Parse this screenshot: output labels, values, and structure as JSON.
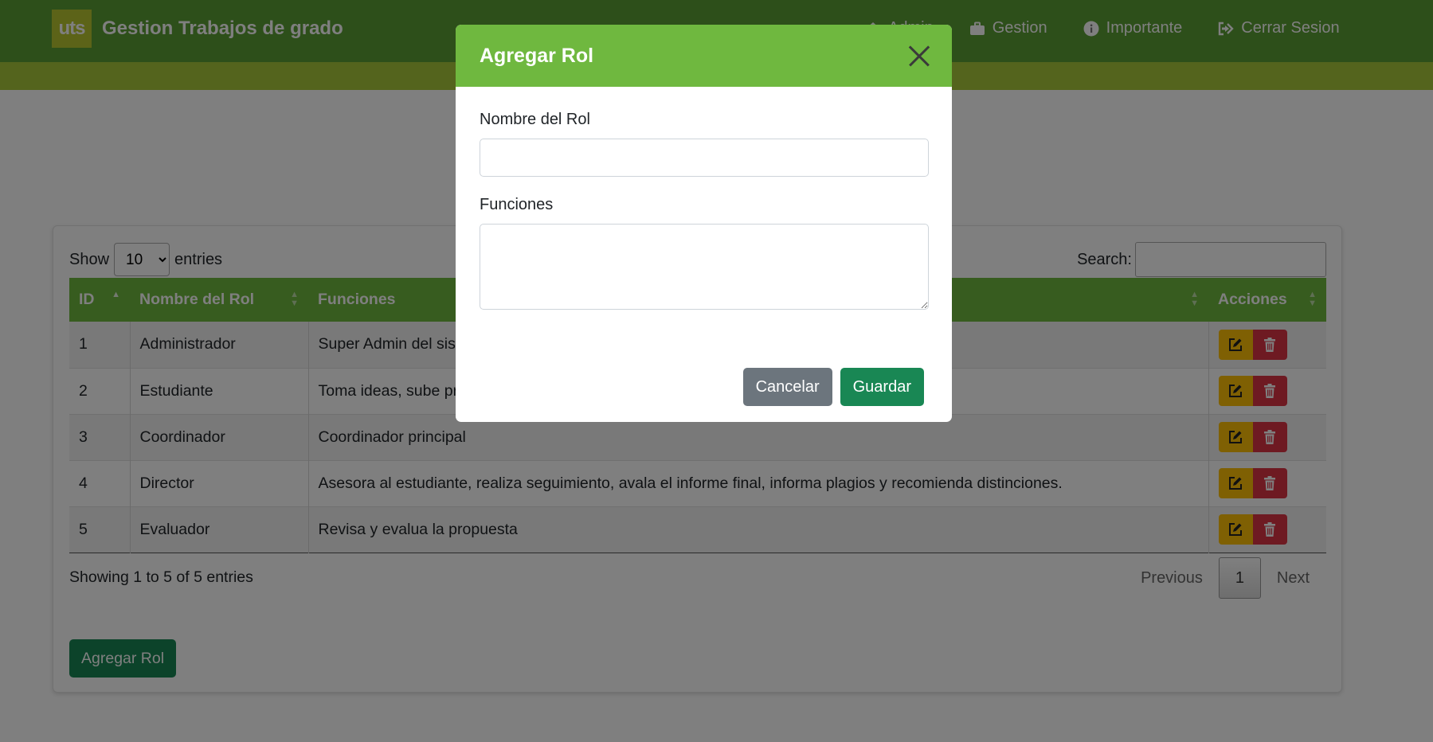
{
  "navbar": {
    "logo_text": "uts",
    "title": "Gestion Trabajos de grado",
    "links": [
      {
        "label": "Admin",
        "icon": "home-icon"
      },
      {
        "label": "Gestion",
        "icon": "briefcase-icon"
      },
      {
        "label": "Importante",
        "icon": "info-icon"
      },
      {
        "label": "Cerrar Sesion",
        "icon": "sign-out-icon"
      }
    ],
    "colors": {
      "bar": "#5a9e34",
      "stripe": "#a8c93a"
    }
  },
  "table_controls": {
    "show_label": "Show",
    "entries_value": "10",
    "entries_label": "entries",
    "search_label": "Search:"
  },
  "table": {
    "headers": [
      "ID",
      "Nombre del Rol",
      "Funciones",
      "Acciones"
    ],
    "rows": [
      {
        "id": "1",
        "name": "Administrador",
        "functions": "Super Admin del sis"
      },
      {
        "id": "2",
        "name": "Estudiante",
        "functions": "Toma ideas, sube pr"
      },
      {
        "id": "3",
        "name": "Coordinador",
        "functions": "Coordinador principal"
      },
      {
        "id": "4",
        "name": "Director",
        "functions": "Asesora al estudiante, realiza seguimiento, avala el informe final, informa plagios y recomienda distinciones."
      },
      {
        "id": "5",
        "name": "Evaluador",
        "functions": "Revisa y evalua la propuesta"
      }
    ]
  },
  "footer": {
    "info": "Showing 1 to 5 of 5 entries",
    "previous": "Previous",
    "current_page": "1",
    "next": "Next",
    "add_button": "Agregar Rol"
  },
  "modal": {
    "title": "Agregar Rol",
    "field_name_label": "Nombre del Rol",
    "field_name_value": "",
    "field_functions_label": "Funciones",
    "field_functions_value": "",
    "cancel_label": "Cancelar",
    "save_label": "Guardar",
    "header_color": "#6fb83f"
  }
}
